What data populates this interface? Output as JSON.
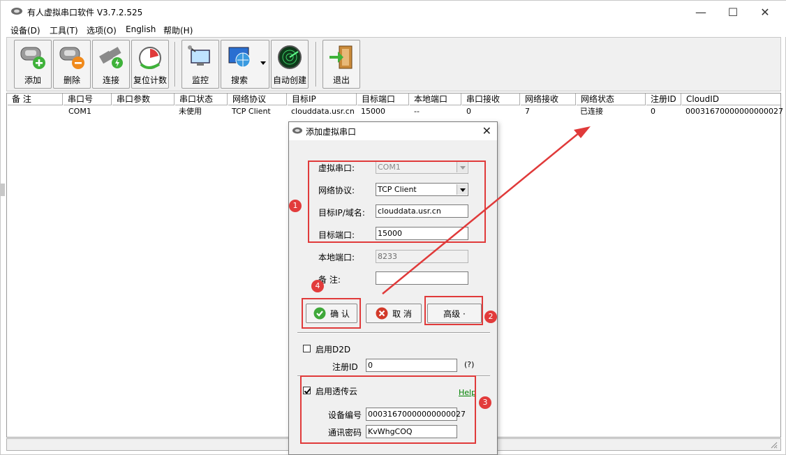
{
  "app": {
    "title": "有人虚拟串口软件 V3.7.2.525"
  },
  "menu": [
    "设备(D)",
    "工具(T)",
    "选项(O)",
    "English",
    "帮助(H)"
  ],
  "toolbar": {
    "add": "添加",
    "delete": "删除",
    "connect": "连接",
    "reset": "复位计数",
    "monitor": "监控",
    "search": "搜索",
    "auto": "自动创建",
    "exit": "退出"
  },
  "grid": {
    "headers": [
      "备 注",
      "串口号",
      "串口参数",
      "串口状态",
      "网络协议",
      "目标IP",
      "目标端口",
      "本地端口",
      "串口接收",
      "网络接收",
      "网络状态",
      "注册ID",
      "CloudID"
    ],
    "rows": [
      [
        "",
        "COM1",
        "",
        "未使用",
        "TCP Client",
        "clouddata.usr.cn",
        "15000",
        "--",
        "0",
        "7",
        "已连接",
        "0",
        "00031670000000000027"
      ]
    ]
  },
  "dialog": {
    "title": "添加虚拟串口",
    "virtual_port_label": "虚拟串口:",
    "virtual_port_value": "COM1",
    "protocol_label": "网络协议:",
    "protocol_value": "TCP Client",
    "target_ip_label": "目标IP/域名:",
    "target_ip_value": "clouddata.usr.cn",
    "target_port_label": "目标端口:",
    "target_port_value": "15000",
    "local_port_label": "本地端口:",
    "local_port_value": "8233",
    "note_label": "备  注:",
    "note_value": "",
    "ok": "确 认",
    "cancel": "取 消",
    "advanced": "高级 ·",
    "d2d_label": "启用D2D",
    "reg_id_label": "注册ID",
    "reg_id_value": "0",
    "reg_help": "(?)",
    "cloud_label": "启用透传云",
    "help": "Help",
    "device_no_label": "设备编号",
    "device_no_value": "00031670000000000027",
    "password_label": "通讯密码",
    "password_value": "KvWhgCOQ"
  },
  "annotations": {
    "b1": "1",
    "b2": "2",
    "b3": "3",
    "b4": "4",
    "accent": "#e03a3a"
  }
}
